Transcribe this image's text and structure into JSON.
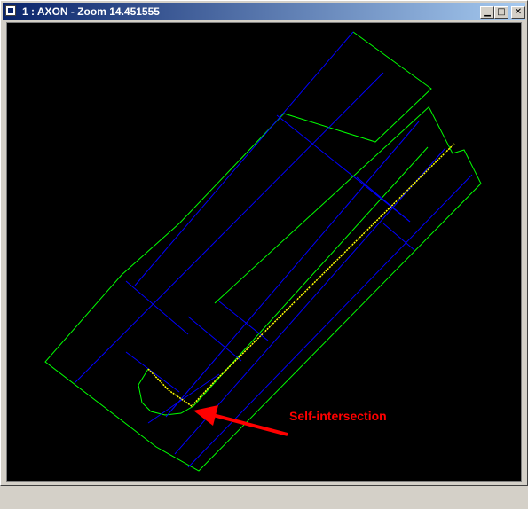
{
  "window": {
    "title": "1 : AXON - Zoom 14.451555",
    "controls": {
      "minimize_glyph": "▁",
      "maximize_glyph": "□",
      "close_glyph": "✕"
    }
  },
  "viewport": {
    "background": "#000000",
    "colors": {
      "outline": "#00ff00",
      "gridline": "#0000ff",
      "path": "#ffff00",
      "annotation": "#ff0000"
    }
  },
  "annotation": {
    "label": "Self-intersection"
  }
}
